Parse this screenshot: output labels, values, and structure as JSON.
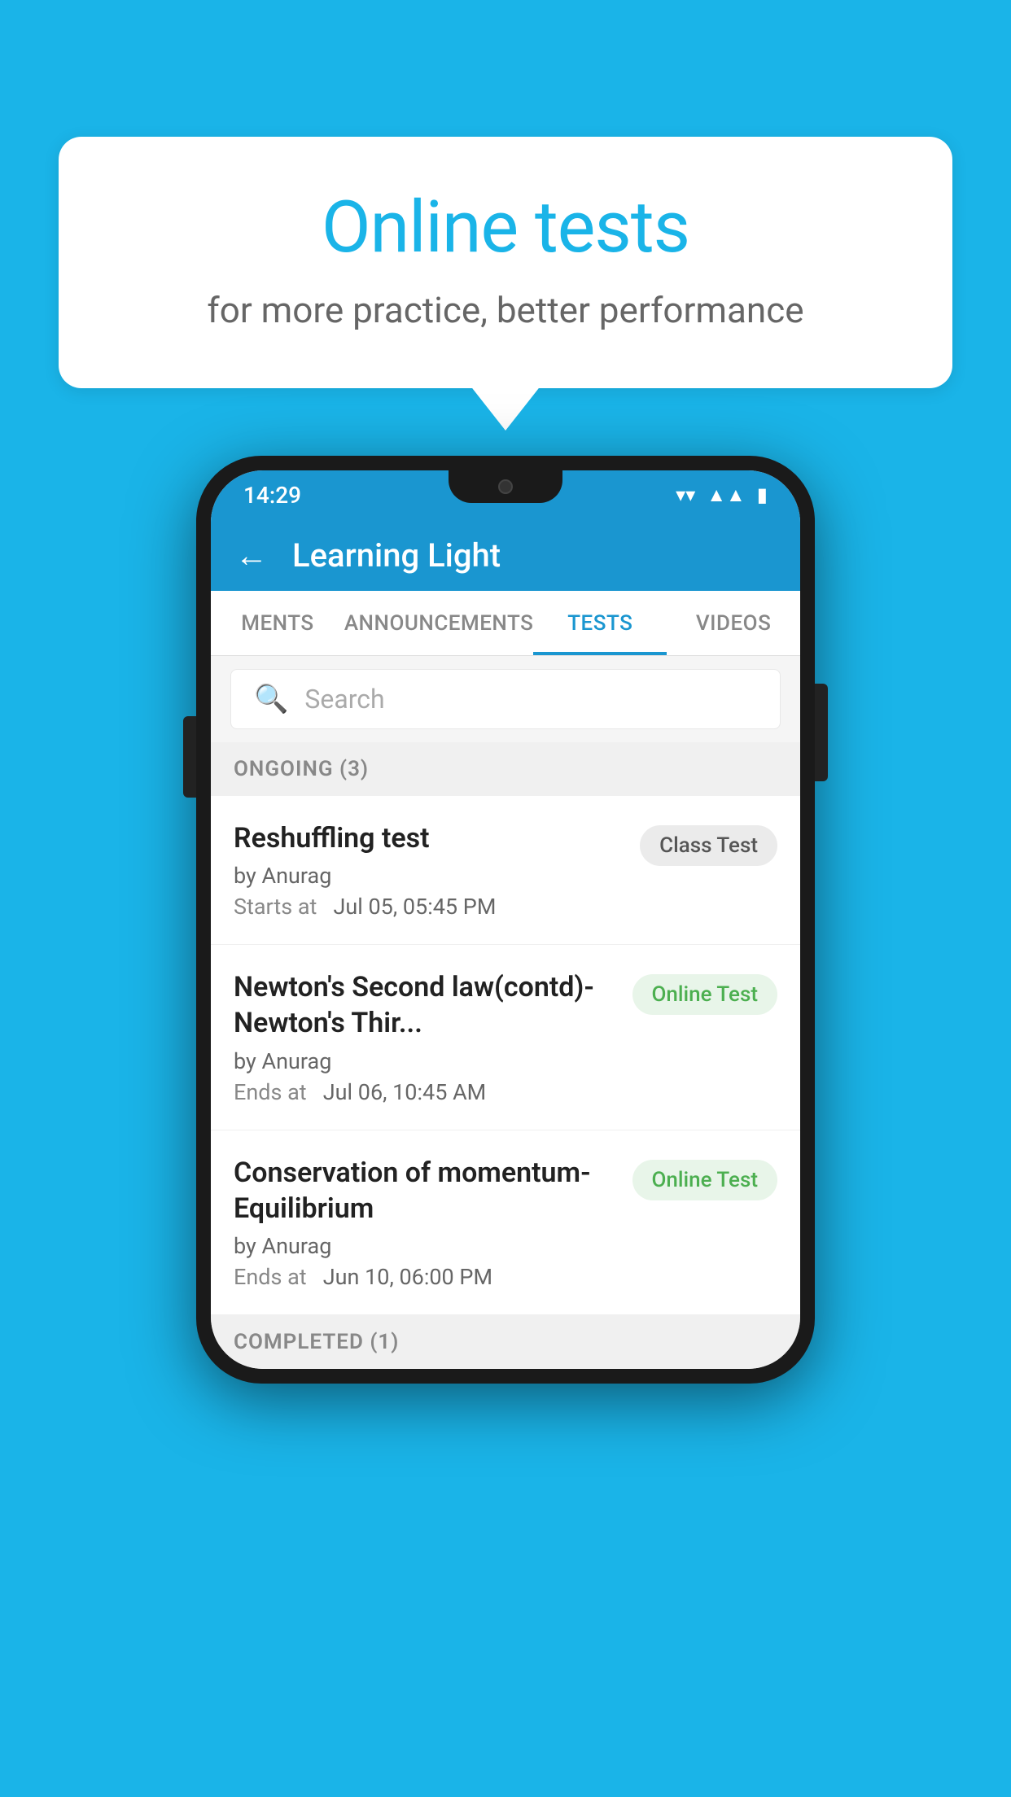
{
  "background_color": "#1ab4e8",
  "speech_bubble": {
    "title": "Online tests",
    "subtitle": "for more practice, better performance"
  },
  "phone": {
    "status_bar": {
      "time": "14:29",
      "icons": [
        "wifi",
        "signal",
        "battery"
      ]
    },
    "app_header": {
      "back_label": "←",
      "title": "Learning Light"
    },
    "tabs": [
      {
        "label": "MENTS",
        "active": false
      },
      {
        "label": "ANNOUNCEMENTS",
        "active": false
      },
      {
        "label": "TESTS",
        "active": true
      },
      {
        "label": "VIDEOS",
        "active": false
      }
    ],
    "search": {
      "placeholder": "Search"
    },
    "ongoing_section": {
      "label": "ONGOING (3)",
      "tests": [
        {
          "name": "Reshuffling test",
          "by": "by Anurag",
          "time_label": "Starts at",
          "time": "Jul 05, 05:45 PM",
          "badge": "Class Test",
          "badge_type": "class"
        },
        {
          "name": "Newton's Second law(contd)-Newton's Thir...",
          "by": "by Anurag",
          "time_label": "Ends at",
          "time": "Jul 06, 10:45 AM",
          "badge": "Online Test",
          "badge_type": "online"
        },
        {
          "name": "Conservation of momentum-Equilibrium",
          "by": "by Anurag",
          "time_label": "Ends at",
          "time": "Jun 10, 06:00 PM",
          "badge": "Online Test",
          "badge_type": "online"
        }
      ]
    },
    "completed_section": {
      "label": "COMPLETED (1)"
    }
  }
}
